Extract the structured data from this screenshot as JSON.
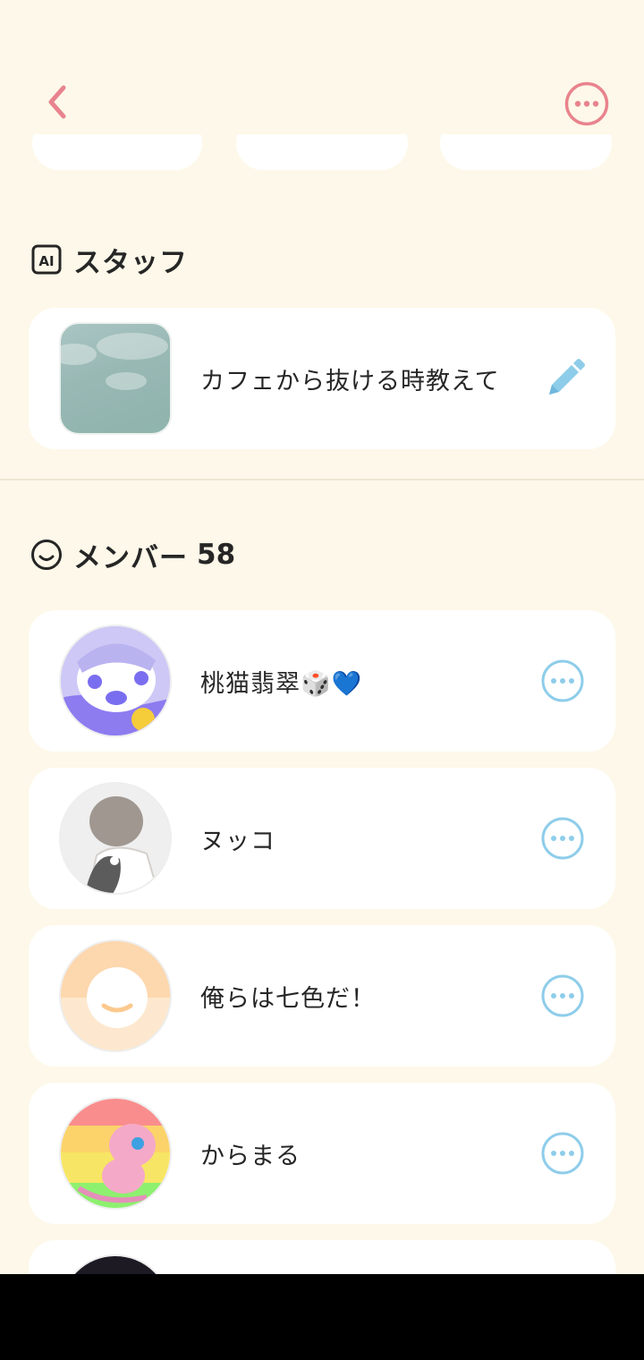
{
  "colors": {
    "background": "#fdf8e9",
    "card": "#ffffff",
    "accent_pink": "#e8838d",
    "accent_blue": "#8ecdea",
    "text": "#262626"
  },
  "nav": {
    "back_icon": "chevron-left-icon",
    "more_icon": "ellipsis-circle-icon"
  },
  "staff": {
    "badge": "AI",
    "title": "スタッフ",
    "item": {
      "label": "カフェから抜ける時教えて",
      "action_icon": "pencil-icon"
    }
  },
  "members": {
    "title": "メンバー",
    "count": "58",
    "items": [
      {
        "name": "桃猫翡翠🎲💙"
      },
      {
        "name": "ヌッコ"
      },
      {
        "name": "俺らは七色だ！"
      },
      {
        "name": "からまる"
      }
    ]
  }
}
